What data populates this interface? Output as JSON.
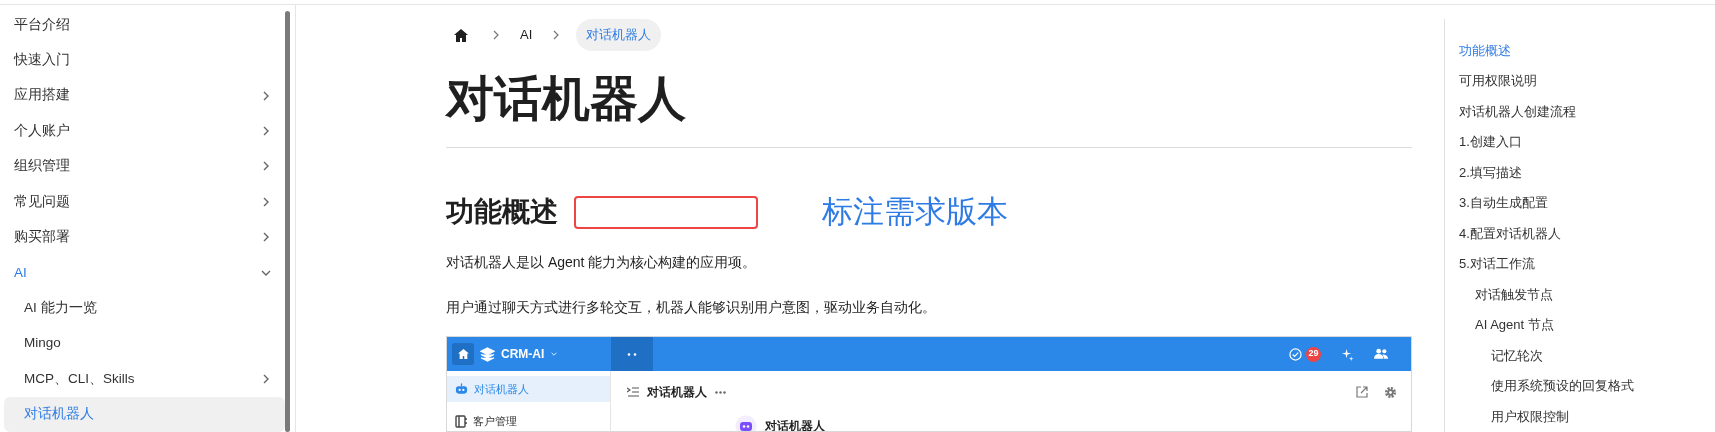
{
  "sidebar": {
    "items": [
      {
        "label": "平台介绍",
        "selected": false
      },
      {
        "label": "快速入门",
        "selected": false
      },
      {
        "label": "应用搭建",
        "selected": false,
        "expanded": false
      },
      {
        "label": "个人账户",
        "selected": false,
        "expanded": false
      },
      {
        "label": "组织管理",
        "selected": false,
        "expanded": false
      },
      {
        "label": "常见问题",
        "selected": false,
        "expanded": false
      },
      {
        "label": "购买部署",
        "selected": false,
        "expanded": false
      },
      {
        "label": "AI",
        "selected": false,
        "expanded": true,
        "children": [
          {
            "label": "AI 能力一览",
            "selected": false
          },
          {
            "label": "Mingo",
            "selected": false
          },
          {
            "label": "MCP、CLI、Skills",
            "selected": false,
            "expanded": false
          },
          {
            "label": "对话机器人",
            "selected": true
          }
        ]
      }
    ]
  },
  "breadcrumb": [
    {
      "label": "AI",
      "selected": false
    },
    {
      "label": "对话机器人",
      "selected": true
    }
  ],
  "article": {
    "title": "对话机器人",
    "section_heading": "功能概述",
    "annotation": "标注需求版本",
    "paragraphs": [
      "对话机器人是以 Agent 能力为核心构建的应用项。",
      "用户通过聊天方式进行多轮交互，机器人能够识别用户意图，驱动业务自动化。"
    ],
    "screenshot": {
      "app_name": "CRM-AI",
      "badge": "29",
      "nav_items": [
        {
          "label": "对话机器人",
          "selected": true
        },
        {
          "label": "客户管理",
          "selected": false
        }
      ],
      "page_title": "对话机器人",
      "card_title": "对话机器人"
    }
  },
  "toc": {
    "items": [
      {
        "label": "功能概述",
        "selected": true
      },
      {
        "label": "可用权限说明",
        "selected": false
      },
      {
        "label": "对话机器人创建流程",
        "selected": false
      },
      {
        "label": "1.创建入口",
        "selected": false
      },
      {
        "label": "2.填写描述",
        "selected": false
      },
      {
        "label": "3.自动生成配置",
        "selected": false
      },
      {
        "label": "4.配置对话机器人",
        "selected": false
      },
      {
        "label": "5.对话工作流",
        "selected": false,
        "children": [
          {
            "label": "对话触发节点",
            "selected": false
          },
          {
            "label": "AI Agent 节点",
            "selected": false,
            "children": [
              {
                "label": "记忆轮次",
                "selected": false
              },
              {
                "label": "使用系统预设的回复格式",
                "selected": false
              },
              {
                "label": "用户权限控制",
                "selected": false
              }
            ]
          }
        ]
      }
    ]
  }
}
